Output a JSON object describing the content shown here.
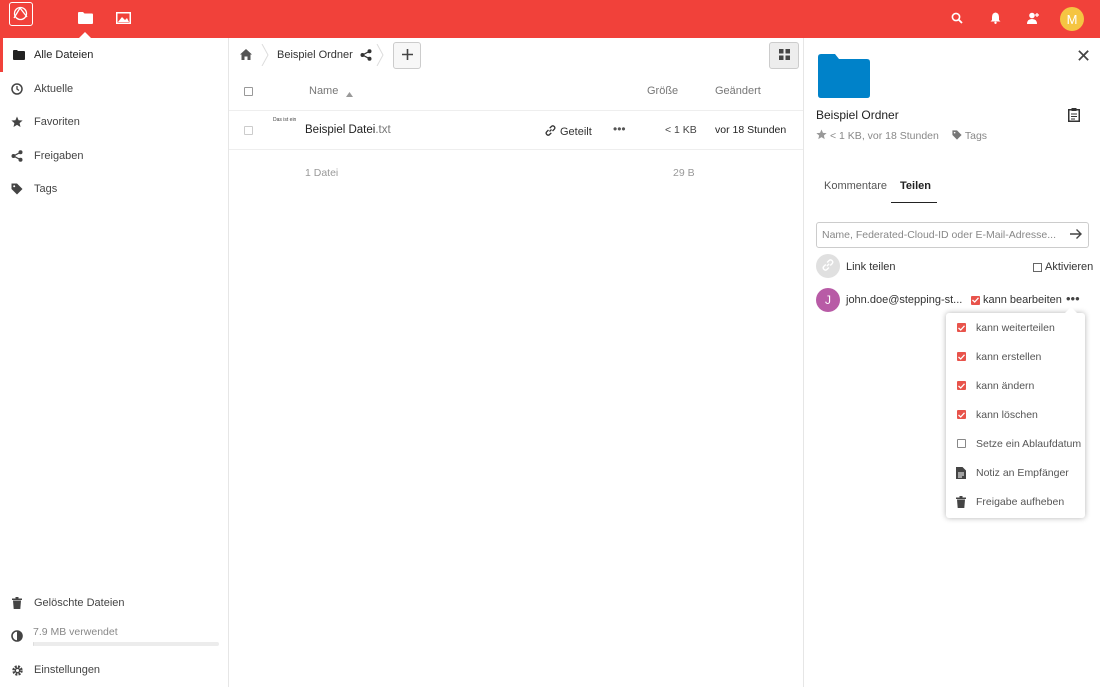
{
  "colors": {
    "brand": "#f1413a",
    "folder": "#0082c9",
    "avatar_m": "#f5c542",
    "avatar_j": "#b85ba6",
    "checkbox_on": "#e8534b"
  },
  "header": {
    "apps": [
      {
        "name": "files-app",
        "icon": "folder-icon"
      },
      {
        "name": "gallery-app",
        "icon": "image-icon"
      }
    ],
    "icons": [
      "search-icon",
      "bell-icon",
      "contacts-icon"
    ],
    "avatar_letter": "M"
  },
  "sidebar": {
    "items": [
      {
        "label": "Alle Dateien",
        "icon": "folder-icon"
      },
      {
        "label": "Aktuelle",
        "icon": "clock-icon"
      },
      {
        "label": "Favoriten",
        "icon": "star-icon"
      },
      {
        "label": "Freigaben",
        "icon": "share-icon"
      },
      {
        "label": "Tags",
        "icon": "tag-icon"
      }
    ],
    "deleted": "Gelöschte Dateien",
    "quota": "7.9 MB verwendet",
    "quota_fraction": 0.005,
    "settings": "Einstellungen"
  },
  "breadcrumb": {
    "folder": "Beispiel Ordner"
  },
  "table": {
    "headers": {
      "name": "Name",
      "size": "Größe",
      "modified": "Geändert"
    },
    "rows": [
      {
        "name": "Beispiel Datei",
        "ext": ".txt",
        "thumb": "Das ist ein",
        "shared": "Geteilt",
        "size": "< 1 KB",
        "modified": "vor 18 Stunden"
      }
    ],
    "summary": {
      "files": "1 Datei",
      "size": "29 B"
    }
  },
  "details": {
    "title": "Beispiel Ordner",
    "meta": "< 1 KB, vor 18 Stunden",
    "tags": "Tags",
    "tabs": [
      "Kommentare",
      "Teilen"
    ],
    "active_tab": "Teilen",
    "share_placeholder": "Name, Federated-Cloud-ID oder E-Mail-Adresse...",
    "link_share": "Link teilen",
    "activate": "Aktivieren",
    "user": {
      "initial": "J",
      "name": "john.doe@stepping-st...",
      "permission": "kann bearbeiten"
    }
  },
  "popover": {
    "items": [
      {
        "label": "kann weiterteilen",
        "icon": "checkbox-checked",
        "checked": true
      },
      {
        "label": "kann erstellen",
        "icon": "checkbox-checked",
        "checked": true
      },
      {
        "label": "kann ändern",
        "icon": "checkbox-checked",
        "checked": true
      },
      {
        "label": "kann löschen",
        "icon": "checkbox-checked",
        "checked": true
      },
      {
        "label": "Setze ein Ablaufdatum",
        "icon": "checkbox-empty",
        "checked": false
      },
      {
        "label": "Notiz an Empfänger",
        "icon": "note-icon"
      },
      {
        "label": "Freigabe aufheben",
        "icon": "trash-icon"
      }
    ]
  }
}
